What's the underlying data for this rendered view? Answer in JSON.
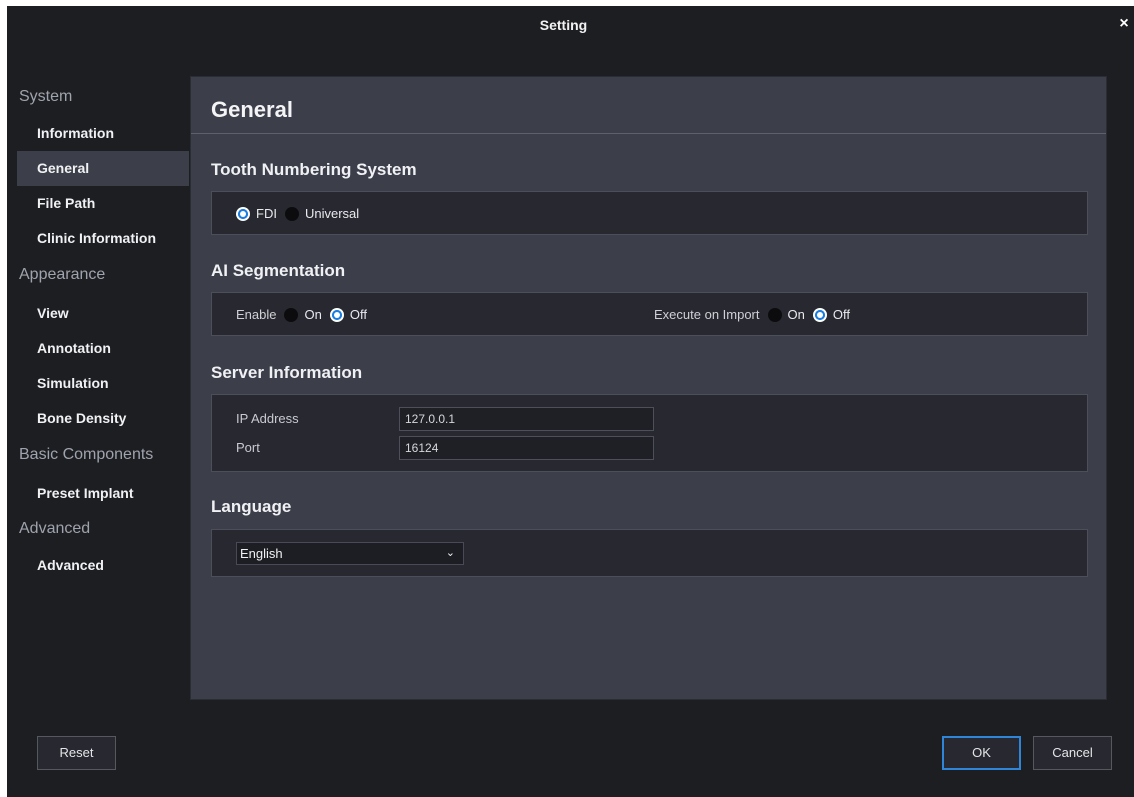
{
  "window": {
    "title": "Setting",
    "close_glyph": "×"
  },
  "sidebar": {
    "categories": [
      "System",
      "Appearance",
      "Basic Components",
      "Advanced"
    ],
    "items": [
      {
        "label": "Information"
      },
      {
        "label": "General"
      },
      {
        "label": "File Path"
      },
      {
        "label": "Clinic Information"
      },
      {
        "label": "View"
      },
      {
        "label": "Annotation"
      },
      {
        "label": "Simulation"
      },
      {
        "label": "Bone Density"
      },
      {
        "label": "Preset Implant"
      },
      {
        "label": "Advanced"
      }
    ],
    "active_item": "General"
  },
  "panel": {
    "title": "General",
    "tooth_numbering": {
      "title": "Tooth Numbering System",
      "options": [
        "FDI",
        "Universal"
      ],
      "selected": "FDI"
    },
    "ai_segmentation": {
      "title": "AI Segmentation",
      "enable_label": "Enable",
      "enable_on": "On",
      "enable_off": "Off",
      "enable_selected": "Off",
      "import_label": "Execute on Import",
      "import_on": "On",
      "import_off": "Off",
      "import_selected": "Off"
    },
    "server": {
      "title": "Server Information",
      "ip_label": "IP Address",
      "ip_value": "127.0.0.1",
      "port_label": "Port",
      "port_value": "16124"
    },
    "language": {
      "title": "Language",
      "selected": "English",
      "chevron": "⌄"
    }
  },
  "footer": {
    "reset": "Reset",
    "ok": "OK",
    "cancel": "Cancel"
  },
  "colors": {
    "accent": "#1a7de0",
    "window_bg": "#1d1e22",
    "panel_bg": "#3c3e4a"
  }
}
